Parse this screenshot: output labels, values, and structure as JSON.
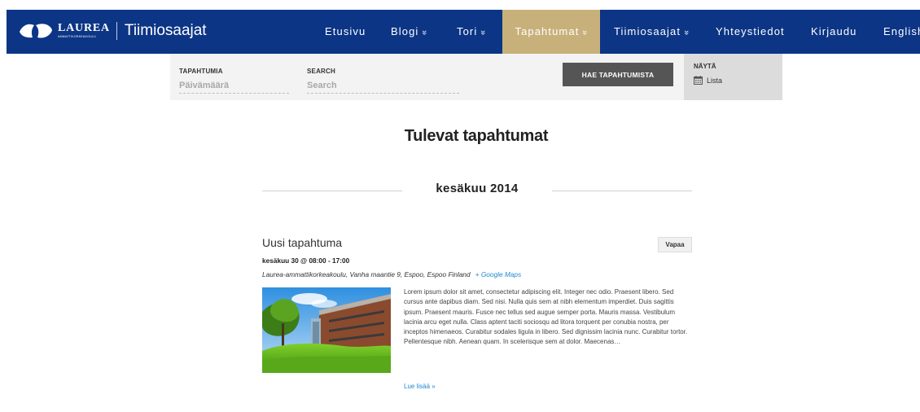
{
  "header": {
    "logo_word": "LAUREA",
    "logo_sub": "AMMATTIKORKEAKOULU",
    "site_name": "Tiimiosaajat",
    "brand_color": "#0c3585",
    "active_color": "#c8b07a",
    "nav": [
      {
        "label": "Etusivu",
        "chevron": ""
      },
      {
        "label": "Blogi",
        "chevron": "»"
      },
      {
        "label": "Tori",
        "chevron": "»"
      },
      {
        "label": "Tapahtumat",
        "chevron": "»",
        "active": true
      },
      {
        "label": "Tiimiosaajat",
        "chevron": "»"
      },
      {
        "label": "Yhteystiedot",
        "chevron": ""
      },
      {
        "label": "Kirjaudu",
        "chevron": ""
      },
      {
        "label": "English",
        "chevron": ""
      }
    ]
  },
  "search": {
    "date_label": "TAPAHTUMIA",
    "date_placeholder": "Päivämäärä",
    "search_label": "SEARCH",
    "search_placeholder": "Search",
    "button_label": "HAE TAPAHTUMISTA",
    "view_label": "NÄYTÄ",
    "view_option": "Lista",
    "view_icon": "calendar-icon"
  },
  "main": {
    "title": "Tulevat tapahtumat",
    "month": "kesäkuu 2014"
  },
  "event": {
    "title": "Uusi tapahtuma",
    "badge": "Vapaa",
    "date": "kesäkuu 30 @ 08:00 - 17:00",
    "venue": "Laurea-ammattikorkeakoulu, Vanha maantie 9, Espoo, Espoo Finland",
    "maps_link": "+ Google Maps",
    "description": "Lorem ipsum dolor sit amet, consectetur adipiscing elit. Integer nec odio. Praesent libero. Sed cursus ante dapibus diam. Sed nisi. Nulla quis sem at nibh elementum imperdiet. Duis sagittis ipsum. Praesent mauris. Fusce nec tellus sed augue semper porta. Mauris massa. Vestibulum lacinia arcu eget nulla. Class aptent taciti sociosqu ad litora torquent per conubia nostra, per inceptos himenaeos. Curabitur sodales ligula in libero. Sed dignissim lacinia nunc. Curabitur tortor. Pellentesque nibh. Aenean quam. In scelerisque sem at dolor. Maecenas…",
    "read_more": "Lue lisää »",
    "link_color": "#1e88d2"
  }
}
